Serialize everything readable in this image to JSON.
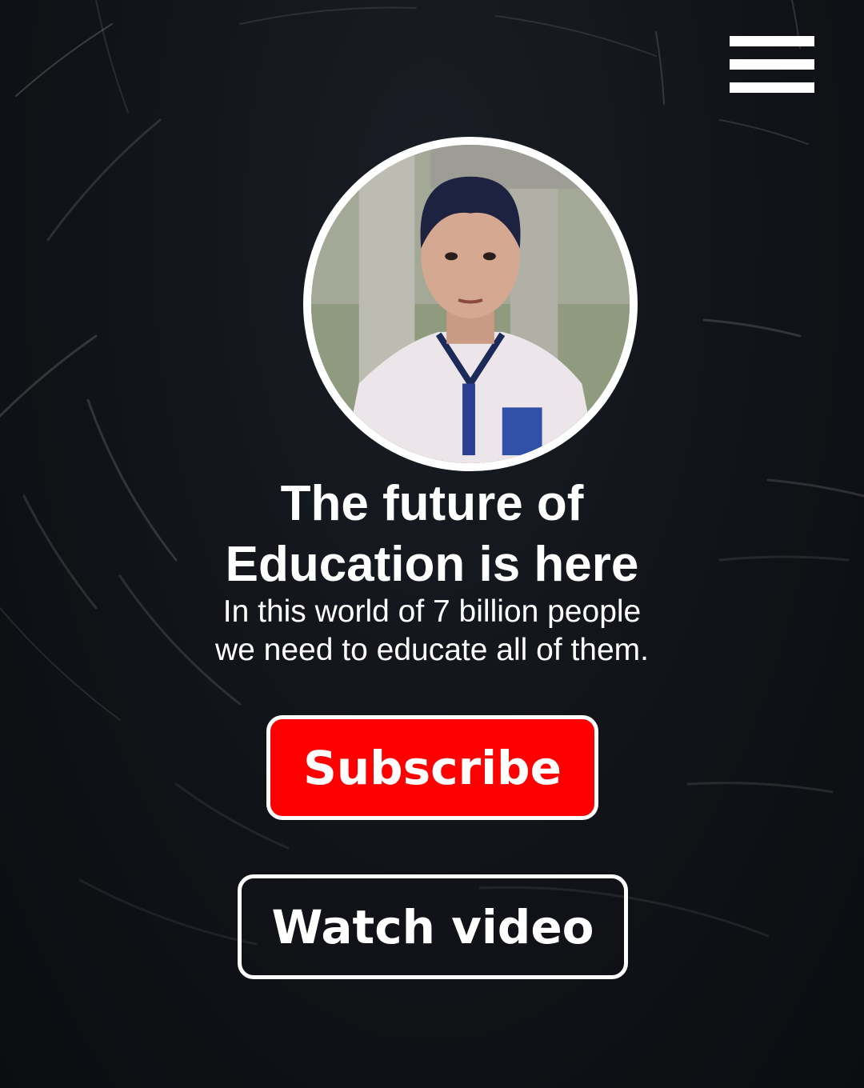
{
  "nav": {
    "menu_icon": "hamburger-menu-icon"
  },
  "hero": {
    "avatar_alt": "profile photo",
    "headline_line1": "The future of",
    "headline_line2": "Education is here",
    "subtitle_line1": "In this world of 7 billion people",
    "subtitle_line2": "we need to educate all of them."
  },
  "actions": {
    "subscribe_label": "Subscribe",
    "watch_label": "Watch video"
  },
  "colors": {
    "background": "#111318",
    "subscribe_bg": "#ff0000",
    "text": "#ffffff",
    "border": "#ffffff"
  }
}
